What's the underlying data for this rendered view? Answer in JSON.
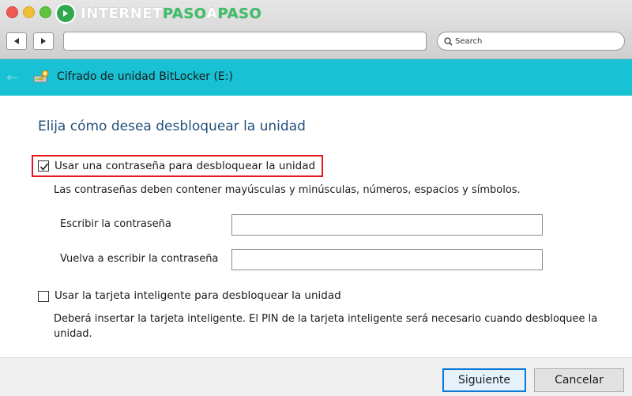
{
  "browser": {
    "logo_text_1": "INTERNET",
    "logo_text_2": "PASO",
    "logo_text_3": "A",
    "logo_text_4": "PASO",
    "search_placeholder": "Search"
  },
  "window": {
    "title": "Cifrado de unidad BitLocker (E:)"
  },
  "main": {
    "heading": "Elija cómo desea desbloquear la unidad",
    "password_option": {
      "label": "Usar una contraseña para desbloquear la unidad",
      "checked": true,
      "description": "Las contraseñas deben contener mayúsculas y minúsculas, números, espacios y símbolos.",
      "enter_label": "Escribir la contraseña",
      "enter_value": "",
      "reenter_label": "Vuelva a escribir la contraseña",
      "reenter_value": ""
    },
    "smartcard_option": {
      "label": "Usar la tarjeta inteligente para desbloquear la unidad",
      "checked": false,
      "description": "Deberá insertar la tarjeta inteligente. El PIN de la tarjeta inteligente será necesario cuando desbloquee la unidad."
    }
  },
  "footer": {
    "next_label": "Siguiente",
    "cancel_label": "Cancelar"
  },
  "colors": {
    "header_bar": "#19c1d4",
    "heading_text": "#1f4e79",
    "highlight_box": "#e0191f",
    "logo_accent": "#3dbf68"
  },
  "icons": {
    "back": "left-arrow",
    "forward": "right-arrow",
    "search": "magnifier",
    "window_back": "back-arrow",
    "bitlocker": "bitlocker-drive-key"
  }
}
